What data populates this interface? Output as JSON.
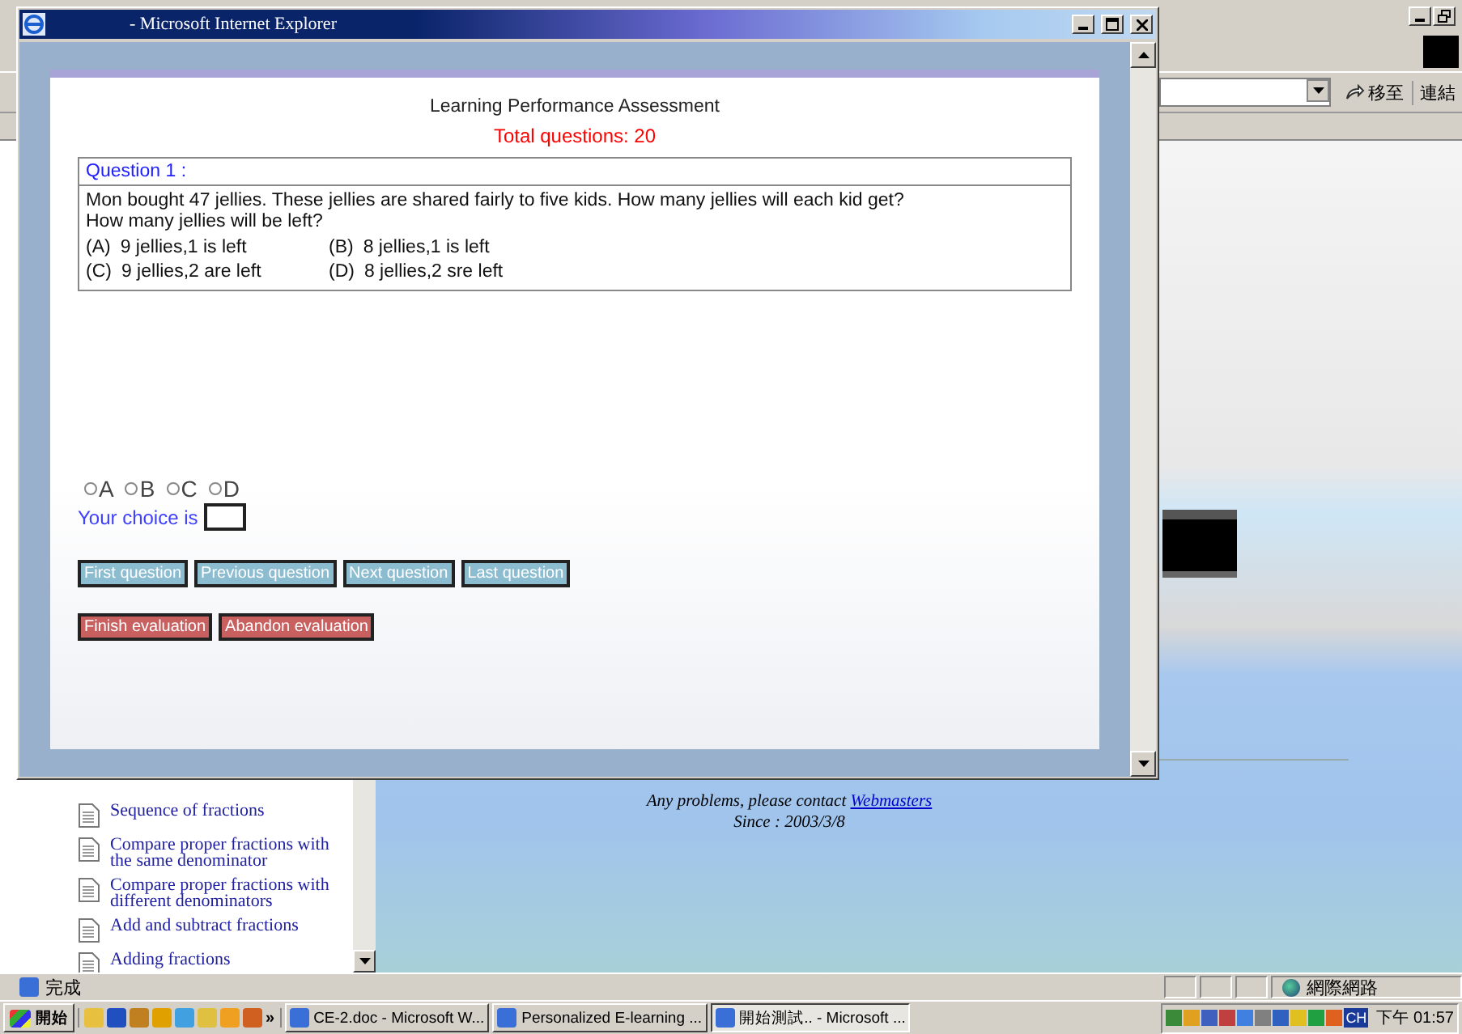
{
  "background_window": {
    "go_button": "移至",
    "links_label": "連結",
    "sidebar": {
      "items": [
        {
          "label": "Sequence of fractions"
        },
        {
          "label": "Compare proper fractions with the same denominator"
        },
        {
          "label": "Compare proper fractions with different denominators"
        },
        {
          "label": "Add and subtract fractions"
        },
        {
          "label": "Adding fractions"
        }
      ]
    },
    "footer": {
      "contact": "Any problems, please contact",
      "contact_link": "Webmasters",
      "since": "Since : 2003/3/8"
    },
    "status_bar": {
      "status": "完成",
      "zone": "網際網路"
    }
  },
  "popup": {
    "title": "- Microsoft Internet Explorer",
    "heading": "Learning Performance Assessment",
    "total": "Total questions: 20",
    "question": {
      "label": "Question 1 :",
      "text": "Mon bought 47 jellies. These jellies are shared fairly to five kids. How many jellies will each kid get?",
      "text_2": "How many jellies will be left?",
      "options": [
        {
          "letter": "(A)",
          "text": "9 jellies,1 is left"
        },
        {
          "letter": "(B)",
          "text": "8 jellies,1 is left"
        },
        {
          "letter": "(C)",
          "text": "9 jellies,2 are left"
        },
        {
          "letter": "(D)",
          "text": "8 jellies,2 sre left"
        }
      ]
    },
    "choices": [
      {
        "label": "A",
        "selected": false
      },
      {
        "label": "B",
        "selected": false
      },
      {
        "label": "C",
        "selected": false
      },
      {
        "label": "D",
        "selected": false
      }
    ],
    "choice_label": "Your choice is",
    "nav_buttons": [
      "First question",
      "Previous question",
      "Next question",
      "Last question"
    ],
    "action_buttons": [
      "Finish evaluation",
      "Abandon evaluation"
    ]
  },
  "taskbar": {
    "start": "開始",
    "more": "»",
    "tasks": [
      {
        "label": "CE-2.doc - Microsoft W...",
        "selected": false
      },
      {
        "label": "Personalized E-learning ...",
        "selected": false
      },
      {
        "label": "開始測試.. - Microsoft ...",
        "selected": true
      }
    ],
    "language": "CH",
    "clock": "下午 01:57"
  }
}
